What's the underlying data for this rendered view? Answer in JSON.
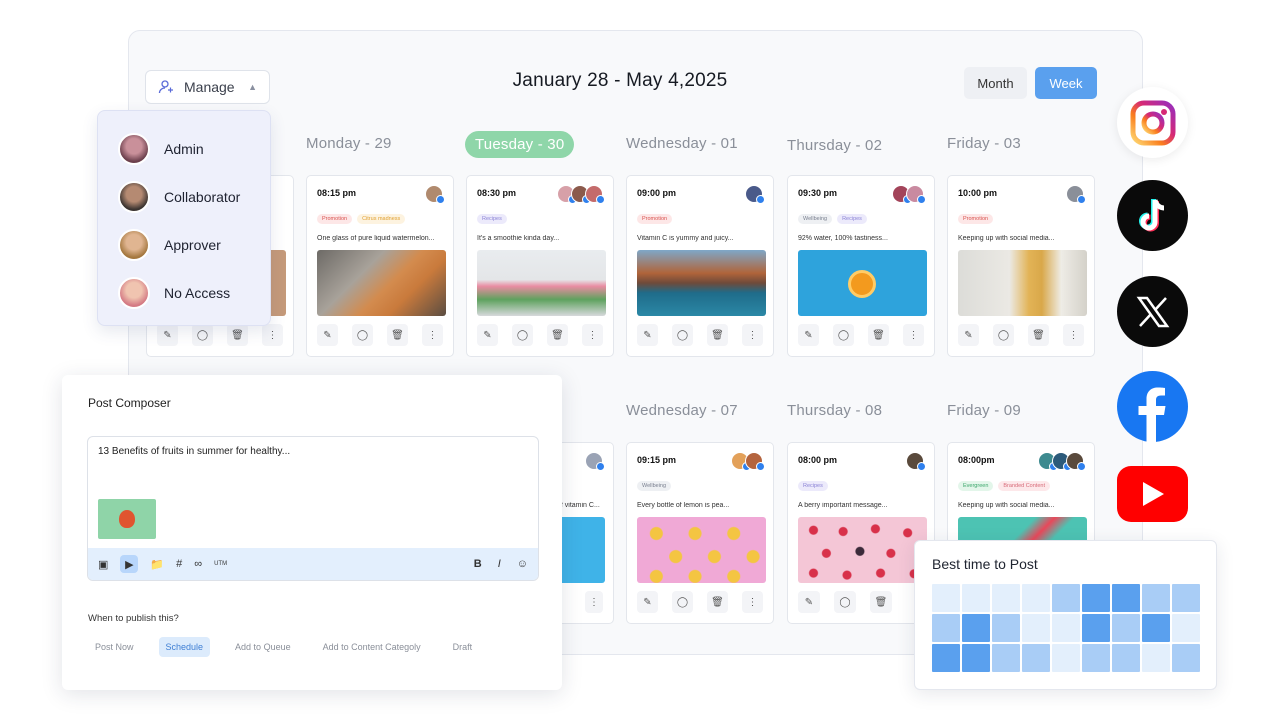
{
  "header": {
    "manage_label": "Manage",
    "range_title": "January 28 - May 4,2025",
    "month_label": "Month",
    "week_label": "Week"
  },
  "week1": {
    "days": [
      "Monday - 29",
      "Tuesday - 30",
      "Wednesday - 01",
      "Thursday - 02",
      "Friday - 03"
    ],
    "cards": [
      {
        "time": "08:15 pm",
        "tags": [
          "Promotion",
          "Citrus madness"
        ],
        "caption": "One glass of pure liquid watermelon..."
      },
      {
        "time": "08:30 pm",
        "tags": [
          "Recipes"
        ],
        "caption": "It's a smoothie kinda day..."
      },
      {
        "time": "09:00 pm",
        "tags": [
          "Promotion"
        ],
        "caption": "Vitamin C is yummy and juicy..."
      },
      {
        "time": "09:30 pm",
        "tags": [
          "Wellbeing",
          "Recipes"
        ],
        "caption": "92% water, 100% tastiness..."
      },
      {
        "time": "10:00 pm",
        "tags": [
          "Promotion"
        ],
        "caption": "Keeping up with social media..."
      }
    ]
  },
  "week2": {
    "days": [
      "Wednesday - 07",
      "Thursday - 08",
      "Friday - 09"
    ],
    "cards": [
      {
        "time": "09:15 pm",
        "tags": [
          "Wellbeing"
        ],
        "caption": "Every bottle of lemon is pea..."
      },
      {
        "time": "08:00 pm",
        "tags": [
          "Recipes"
        ],
        "caption": "A berry important message..."
      },
      {
        "time": "08:00pm",
        "tags": [
          "Evergreen",
          "Branded Content"
        ],
        "caption": "Keeping up with social media..."
      }
    ],
    "partial_caption": "of vitamin C..."
  },
  "roles": [
    "Admin",
    "Collaborator",
    "Approver",
    "No Access"
  ],
  "composer": {
    "title": "Post Composer",
    "text": "13 Benefits of fruits in summer for healthy...",
    "utm": "UTM",
    "when_label": "When to publish this?",
    "options": [
      "Post Now",
      "Schedule",
      "Add to Queue",
      "Add to Content Categoly",
      "Draft"
    ],
    "selected_option": "Schedule"
  },
  "social": [
    "instagram-icon",
    "tiktok-icon",
    "x-icon",
    "facebook-icon",
    "youtube-icon"
  ],
  "best_time": {
    "title": "Best time to Post",
    "levels": [
      [
        1,
        1,
        1,
        1,
        2,
        3,
        3,
        2,
        2
      ],
      [
        2,
        3,
        2,
        1,
        1,
        3,
        2,
        3,
        1
      ],
      [
        3,
        3,
        2,
        2,
        1,
        2,
        2,
        1,
        2
      ]
    ]
  },
  "colors": {
    "accent": "#5aa0ee",
    "today": "#8fd6a9"
  }
}
